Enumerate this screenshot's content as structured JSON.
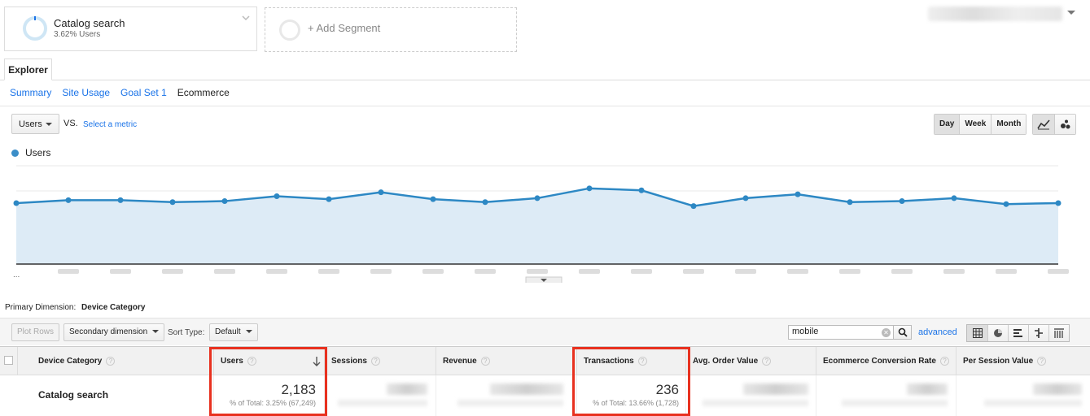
{
  "segments": {
    "active": {
      "title": "Catalog search",
      "subtitle": "3.62% Users"
    },
    "add_label": "+ Add Segment"
  },
  "tabs": {
    "explorer": "Explorer"
  },
  "subtabs": [
    "Summary",
    "Site Usage",
    "Goal Set 1",
    "Ecommerce"
  ],
  "metric": {
    "selected": "Users",
    "vs": "VS.",
    "select_metric": "Select a metric"
  },
  "granularity": [
    "Day",
    "Week",
    "Month"
  ],
  "legend": {
    "series": "Users",
    "color": "#3b8ec8"
  },
  "chart_data": {
    "type": "area",
    "series": [
      {
        "name": "Users",
        "values": [
          62,
          65,
          65,
          63,
          64,
          69,
          66,
          73,
          66,
          63,
          67,
          77,
          75,
          59,
          67,
          71,
          63,
          64,
          67,
          61,
          62
        ]
      }
    ],
    "ylim": [
      0,
      100
    ],
    "x_start_label": "..."
  },
  "primary_dimension": {
    "label": "Primary Dimension:",
    "value": "Device Category"
  },
  "toolbar": {
    "plot_rows": "Plot Rows",
    "secondary_dimension": "Secondary dimension",
    "sort_type_label": "Sort Type:",
    "sort_type": "Default",
    "search_value": "mobile",
    "advanced": "advanced"
  },
  "table": {
    "columns": [
      "Device Category",
      "Users",
      "Sessions",
      "Revenue",
      "Transactions",
      "Avg. Order Value",
      "Ecommerce Conversion Rate",
      "Per Session Value"
    ],
    "row": {
      "label": "Catalog search",
      "users": "2,183",
      "users_pct": "% of Total: 3.25% (67,249)",
      "transactions": "236",
      "transactions_pct": "% of Total: 13.66% (1,728)"
    }
  },
  "colors": {
    "accent": "#1a73e8",
    "highlight": "#e8311f",
    "line": "#2d88c4",
    "area": "#ddebf6"
  }
}
